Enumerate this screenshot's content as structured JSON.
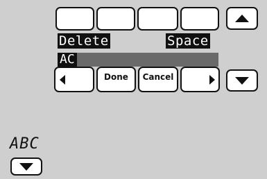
{
  "keypad_top_row": [
    "",
    "",
    "",
    ""
  ],
  "actions": {
    "delete_label": "Delete",
    "space_label": "Space"
  },
  "entry": {
    "value": "AC"
  },
  "nav_row": {
    "done_label": "Done",
    "cancel_label": "Cancel"
  },
  "mode_indicator": "ABC",
  "icons": {
    "scroll_up": "triangle-up-icon",
    "scroll_down": "triangle-down-icon",
    "cursor_left": "triangle-left-icon",
    "cursor_right": "triangle-right-icon",
    "mode_toggle": "triangle-down-icon"
  },
  "colors": {
    "background": "#cfcfcf",
    "key_fill": "#ffffff",
    "ink": "#111111",
    "entry_bar": "#6a6a6a"
  }
}
